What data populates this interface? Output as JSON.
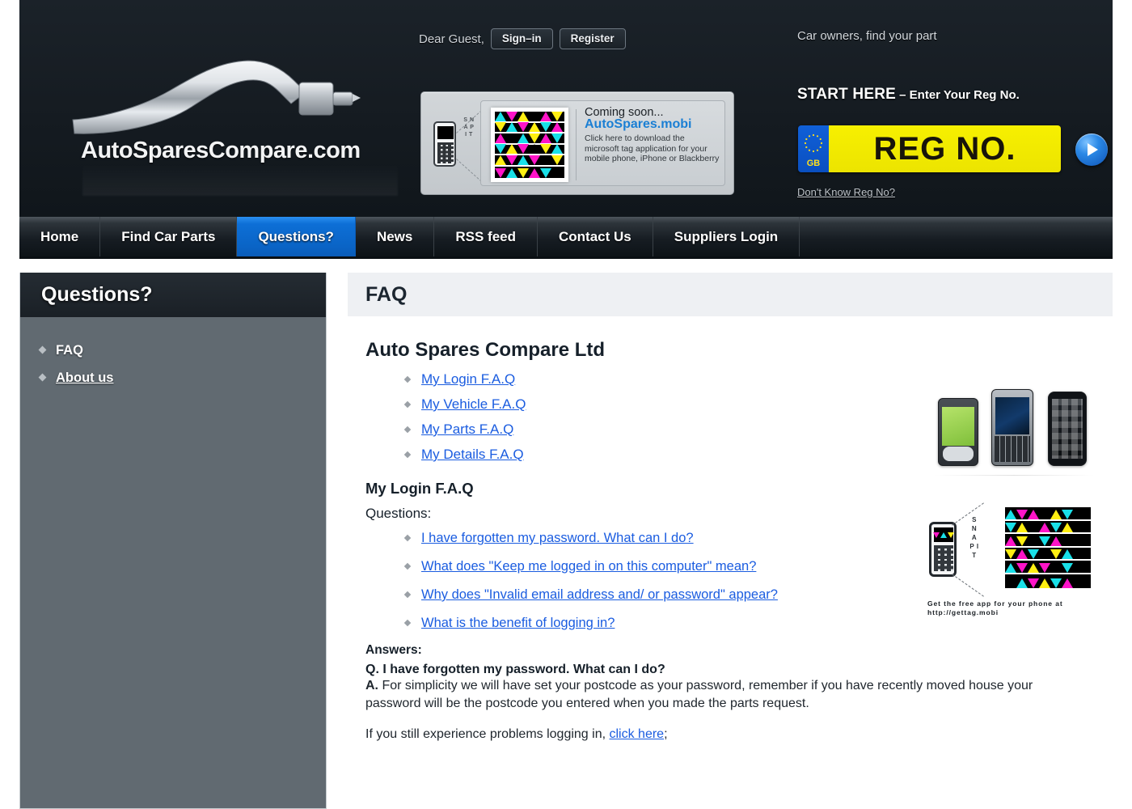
{
  "header": {
    "greeting": "Dear Guest,",
    "signin_label": "Sign–in",
    "register_label": "Register",
    "logo_text": "AutoSparesCompare.com",
    "car_owners_text": "Car owners, find your part",
    "start_here_strong": "START HERE",
    "start_here_rest": "– Enter Your Reg No.",
    "reg_plate_text": "REG NO.",
    "reg_plate_country": "GB",
    "dont_know_reg": "Don't Know Reg No?"
  },
  "tag_promo": {
    "snap_it": "S N A P  I T",
    "coming_soon": "Coming soon...",
    "brand": "AutoSpares.mobi",
    "description": "Click here to download the microsoft tag application for your mobile phone, iPhone or Blackberry"
  },
  "nav": {
    "items": [
      {
        "label": "Home",
        "active": false
      },
      {
        "label": "Find Car Parts",
        "active": false
      },
      {
        "label": "Questions?",
        "active": true
      },
      {
        "label": "News",
        "active": false
      },
      {
        "label": "RSS feed",
        "active": false
      },
      {
        "label": "Contact Us",
        "active": false
      },
      {
        "label": "Suppliers Login",
        "active": false
      }
    ]
  },
  "sidebar": {
    "title": "Questions?",
    "items": [
      {
        "label": "FAQ",
        "is_link": false
      },
      {
        "label": "About us",
        "is_link": true
      }
    ]
  },
  "main": {
    "page_title": "FAQ",
    "company_heading": "Auto Spares Compare Ltd",
    "category_links": [
      "My Login F.A.Q",
      "My Vehicle F.A.Q",
      "My Parts F.A.Q",
      "My Details F.A.Q"
    ],
    "section_heading": "My Login F.A.Q",
    "questions_label": "Questions:",
    "questions": [
      "I have forgotten my password. What can I do?",
      "What does \"Keep me logged in on this computer\" mean?",
      "Why does \"Invalid email address and/ or password\" appear?",
      "What is the benefit of logging in?"
    ],
    "answers_label": "Answers:",
    "answer_question": "Q. I have forgotten my password. What can I do?",
    "answer_prefix": "A.",
    "answer_text": " For simplicity we will have set your postcode as your password, remember if you have recently moved house your password will be the postcode you entered when you made the parts request.",
    "footer_text_before": "If you still experience problems logging in, ",
    "footer_link": "click here",
    "footer_text_after": ";"
  },
  "sidebar_images": {
    "tag_caption_line1": "Get the free app for your phone at",
    "tag_caption_line2": "http://gettag.mobi",
    "snap_it": "S N A P  I T"
  },
  "colors": {
    "header_bg": "#161d24",
    "nav_active": "#0a6fd8",
    "sidebar_bg": "#616a71",
    "link_blue": "#1a5ce0",
    "plate_yellow": "#f2ea00",
    "title_bar_bg": "#eef0f3"
  }
}
